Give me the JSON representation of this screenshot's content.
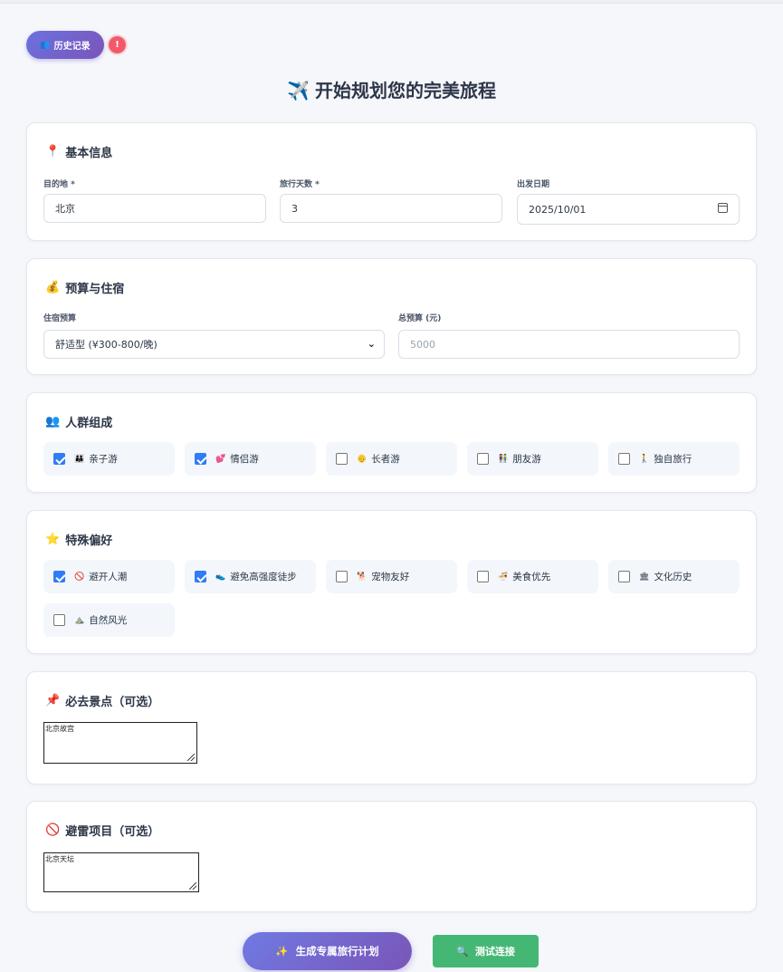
{
  "header": {
    "history_label": "历史记录",
    "history_icon": "user-icon",
    "alert_badge": "!",
    "title": "开始规划您的完美旅程",
    "title_icon": "airplane-icon"
  },
  "basic_info": {
    "title": "基本信息",
    "title_icon": "pin-icon",
    "destination_label": "目的地 *",
    "destination_value": "北京",
    "days_label": "旅行天数 *",
    "days_value": "3",
    "date_label": "出发日期",
    "date_value": "2025/10/01"
  },
  "budget": {
    "title": "预算与住宿",
    "title_icon": "money-bag-icon",
    "lodging_label": "住宿预算",
    "lodging_selected": "舒适型 (¥300-800/晚)",
    "total_label": "总预算 (元)",
    "total_placeholder": "5000"
  },
  "group": {
    "title": "人群组成",
    "title_icon": "people-icon",
    "options": [
      {
        "label": "亲子游",
        "icon": "family-icon",
        "checked": true
      },
      {
        "label": "情侣游",
        "icon": "hearts-icon",
        "checked": true
      },
      {
        "label": "长者游",
        "icon": "elder-icon",
        "checked": false
      },
      {
        "label": "朋友游",
        "icon": "friends-icon",
        "checked": false
      },
      {
        "label": "独自旅行",
        "icon": "walker-icon",
        "checked": false
      }
    ]
  },
  "preferences": {
    "title": "特殊偏好",
    "title_icon": "star-icon",
    "options": [
      {
        "label": "避开人潮",
        "icon": "no-entry-icon",
        "checked": true
      },
      {
        "label": "避免高强度徒步",
        "icon": "shoe-icon",
        "checked": true
      },
      {
        "label": "宠物友好",
        "icon": "pet-icon",
        "checked": false
      },
      {
        "label": "美食优先",
        "icon": "food-icon",
        "checked": false
      },
      {
        "label": "文化历史",
        "icon": "museum-icon",
        "checked": false
      },
      {
        "label": "自然风光",
        "icon": "mountain-icon",
        "checked": false
      }
    ]
  },
  "must_visit": {
    "title": "必去景点（可选）",
    "title_icon": "pushpin-icon",
    "value": "北京故宫"
  },
  "avoid": {
    "title": "避雷项目（可选）",
    "title_icon": "prohibited-icon",
    "value": "北京天坛"
  },
  "actions": {
    "generate_label": "生成专属旅行计划",
    "generate_icon": "sparkles-icon",
    "test_label": "测试连接",
    "test_icon": "magnifier-icon"
  },
  "colors": {
    "primary_gradient_start": "#6b72e0",
    "primary_gradient_end": "#7b54b9",
    "checkbox_blue": "#2f7cf6",
    "test_green": "#45b774",
    "badge_red": "#f25a6b"
  }
}
